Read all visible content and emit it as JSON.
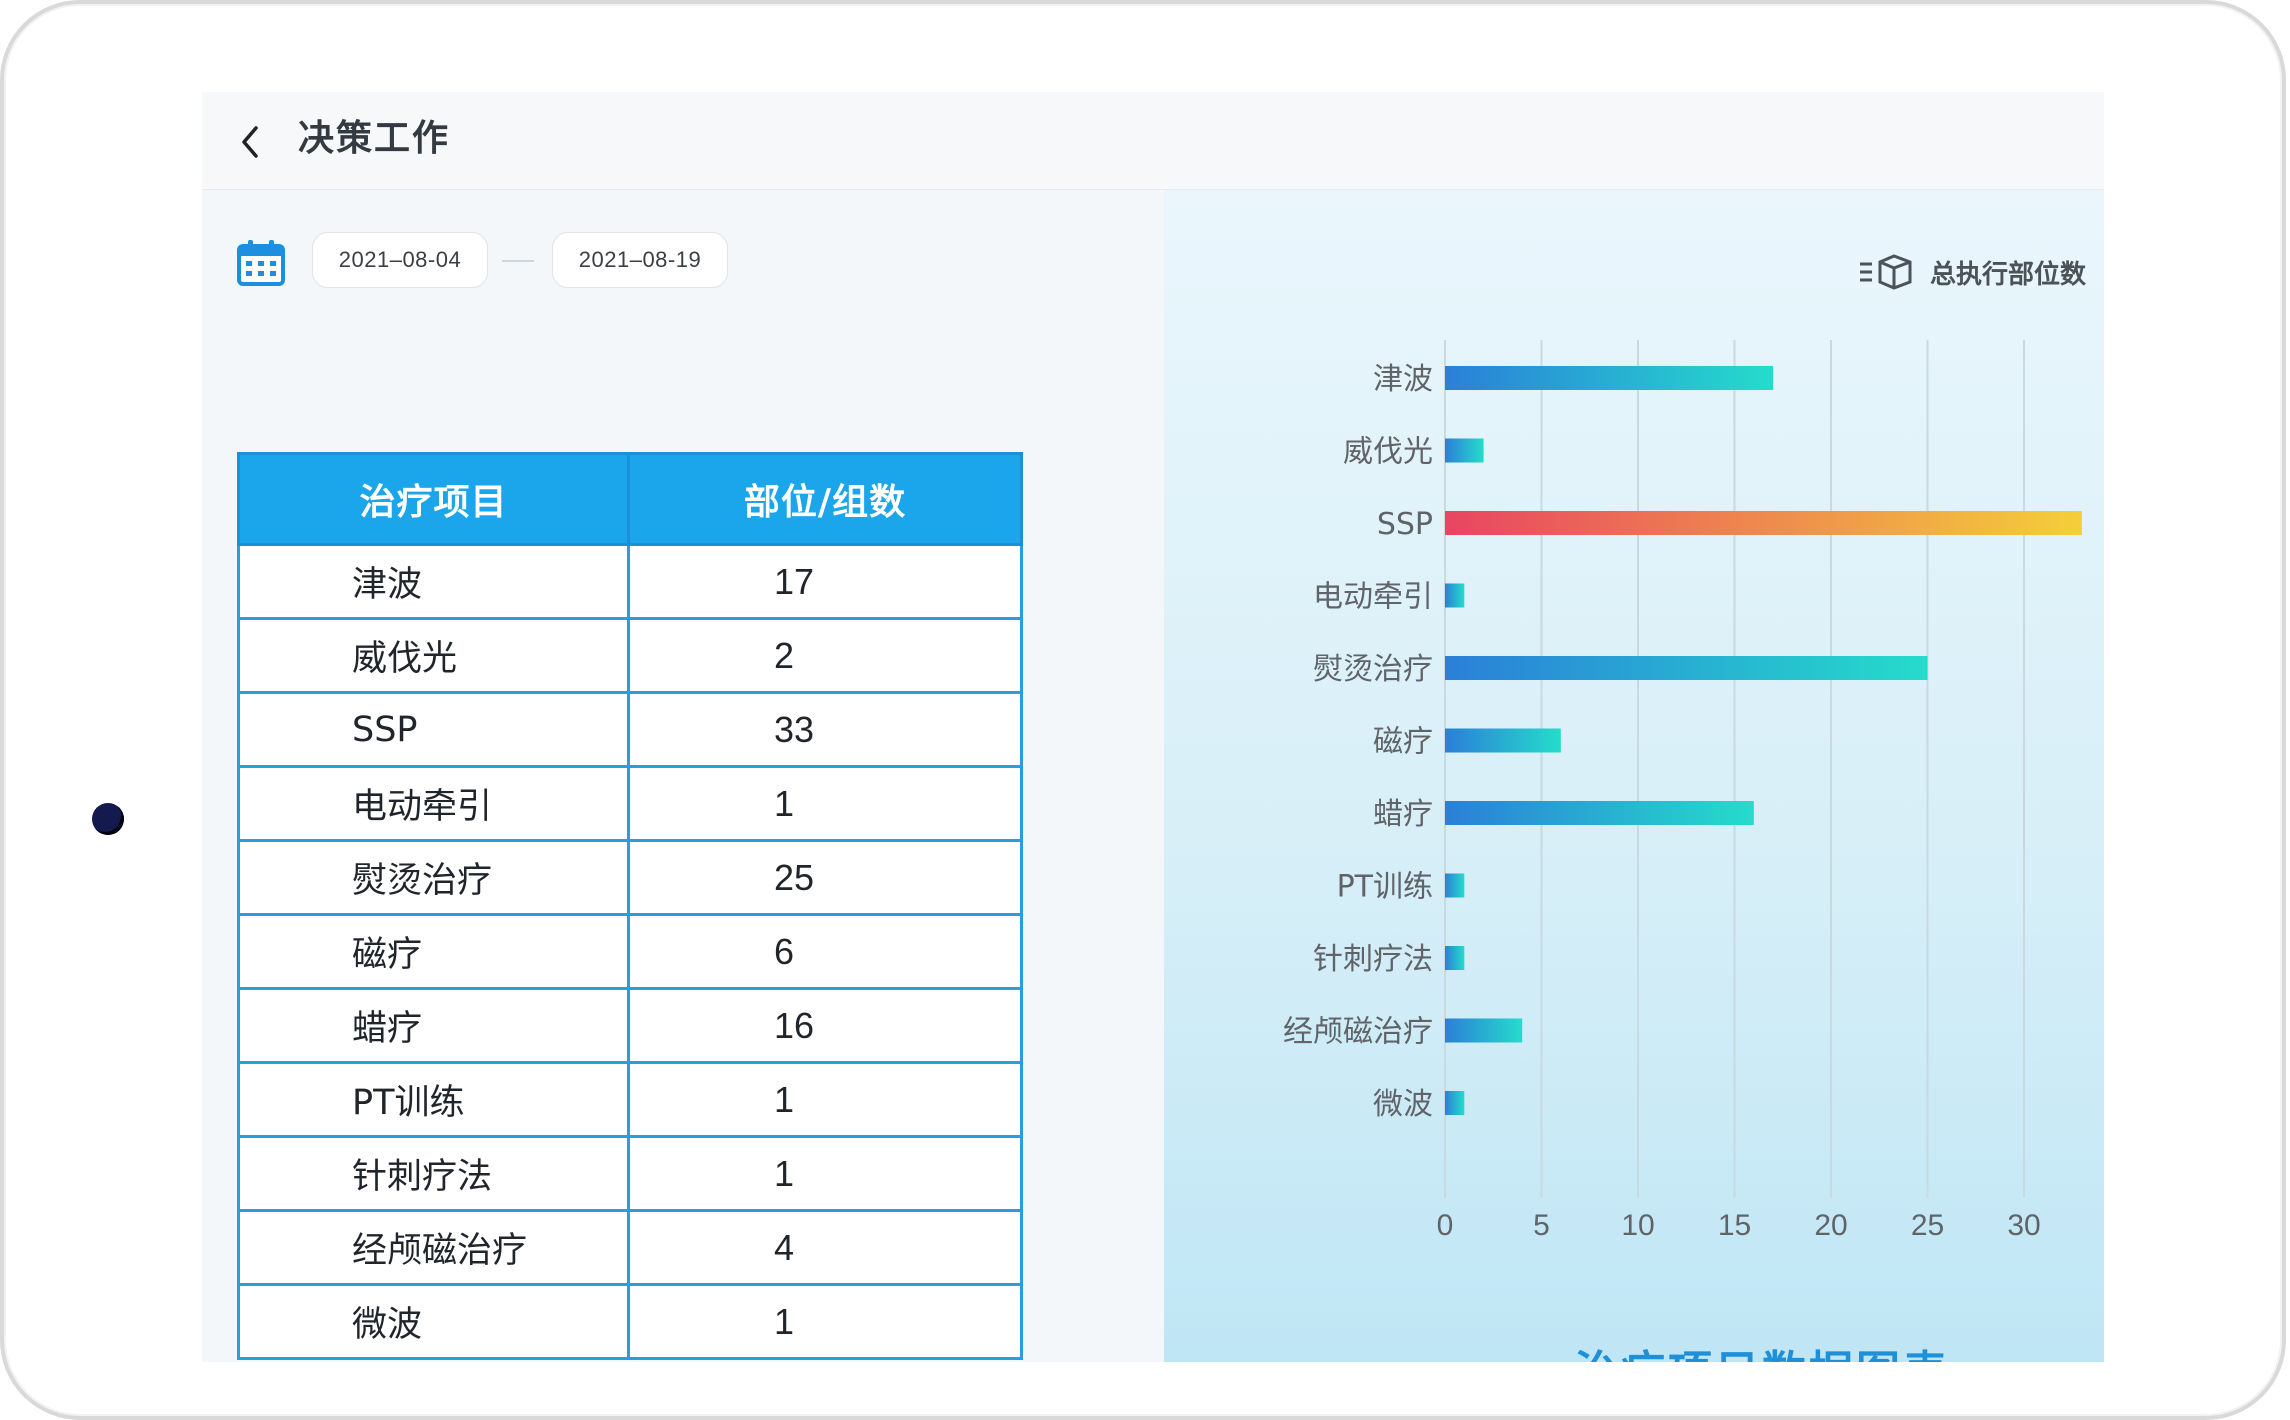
{
  "header": {
    "title": "决策工作"
  },
  "filters": {
    "start_date": "2021–08-04",
    "end_date": "2021–08-19"
  },
  "table": {
    "headers": [
      "治疗项目",
      "部位/组数"
    ],
    "rows": [
      [
        "津波",
        "17"
      ],
      [
        "威伐光",
        "2"
      ],
      [
        "SSP",
        "33"
      ],
      [
        "电动牵引",
        "1"
      ],
      [
        "熨烫治疗",
        "25"
      ],
      [
        "磁疗",
        "6"
      ],
      [
        "蜡疗",
        "16"
      ],
      [
        "PT训练",
        "1"
      ],
      [
        "针刺疗法",
        "1"
      ],
      [
        "经颅磁治疗",
        "4"
      ],
      [
        "微波",
        "1"
      ]
    ]
  },
  "chart_data": {
    "type": "bar",
    "orientation": "horizontal",
    "title": "治疗项目数据图表",
    "legend": "总执行部位数",
    "legend_position": "top-right",
    "categories": [
      "津波",
      "威伐光",
      "SSP",
      "电动牵引",
      "熨烫治疗",
      "磁疗",
      "蜡疗",
      "PT训练",
      "针刺疗法",
      "经颅磁治疗",
      "微波"
    ],
    "series": [
      {
        "name": "总执行部位数",
        "values": [
          17,
          2,
          33,
          1,
          25,
          6,
          16,
          1,
          1,
          4,
          1
        ]
      }
    ],
    "xticks": [
      "0",
      "5",
      "10",
      "15",
      "20",
      "25",
      "30"
    ],
    "xlim": [
      0,
      33
    ],
    "grid": true,
    "colors": {
      "bar_start": "#2b7fd8",
      "bar_end": "#25dccb",
      "highlight_start": "#e84563",
      "highlight_end": "#f4cf3a",
      "grid": "#c8d9e0",
      "label": "#606468"
    }
  }
}
